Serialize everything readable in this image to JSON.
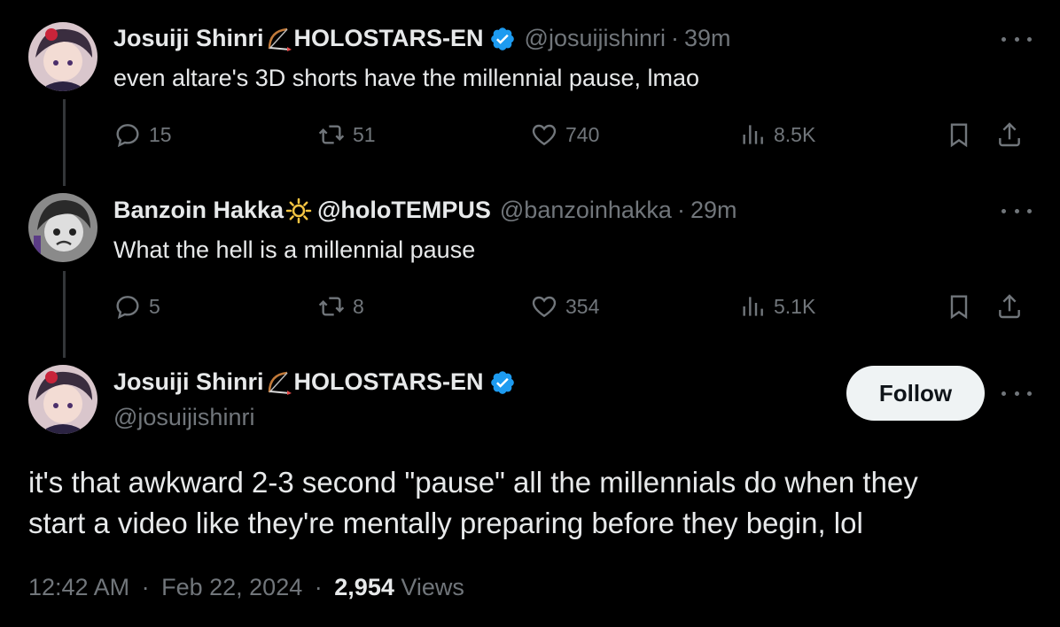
{
  "tweet1": {
    "display_name": "Josuiji Shinri",
    "affiliation": "HOLOSTARS-EN",
    "handle": "@josuijishinri",
    "time": "39m",
    "text": "even altare's 3D shorts have the millennial pause, lmao",
    "stats": {
      "replies": "15",
      "reposts": "51",
      "likes": "740",
      "views": "8.5K"
    }
  },
  "tweet2": {
    "display_name": "Banzoin Hakka",
    "affiliation": "@holoTEMPUS",
    "handle": "@banzoinhakka",
    "time": "29m",
    "text": "What the hell is a millennial pause",
    "stats": {
      "replies": "5",
      "reposts": "8",
      "likes": "354",
      "views": "5.1K"
    }
  },
  "main": {
    "display_name": "Josuiji Shinri",
    "affiliation": "HOLOSTARS-EN",
    "handle": "@josuijishinri",
    "follow_label": "Follow",
    "text_line1": "it's that awkward 2-3 second \"pause\" all the millennials do when they",
    "text_line2": "start a video like they're mentally preparing before they begin, lol",
    "meta_time": "12:42 AM",
    "meta_date": "Feb 22, 2024",
    "meta_views_count": "2,954",
    "meta_views_label": "Views",
    "separator": "·"
  },
  "colors": {
    "background": "#000000",
    "text": "#e7e9ea",
    "muted": "#71767b",
    "verified": "#1d9bf0"
  }
}
